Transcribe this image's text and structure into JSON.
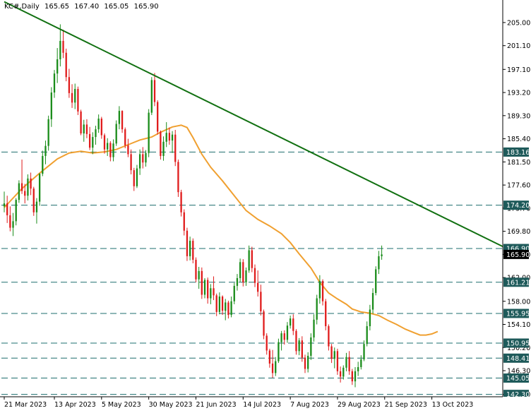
{
  "header": {
    "symbol": "KC#,Daily",
    "open": "165.65",
    "high": "167.40",
    "low": "165.05",
    "close": "165.90"
  },
  "colors": {
    "background": "#ffffff",
    "bull": "#1a8c1a",
    "bear": "#e01b1b",
    "ma": "#f0a030",
    "trendline": "#117011",
    "level": "#1e6f6f",
    "label_bg": "#1e5a5a",
    "price_bg": "#000000",
    "axis": "#000000"
  },
  "chart_data": {
    "type": "candlestick",
    "title": "KC#,Daily",
    "ylim": [
      141.9,
      208.8
    ],
    "y_ticks": [
      "205.00",
      "201.10",
      "197.10",
      "193.20",
      "189.30",
      "185.40",
      "181.50",
      "177.60",
      "173.70",
      "169.80",
      "165.90",
      "162.00",
      "158.00",
      "154.10",
      "150.20",
      "146.30",
      "142.30"
    ],
    "x_tick_labels": [
      {
        "label": "21 Mar 2023",
        "index": 0
      },
      {
        "label": "13 Apr 2023",
        "index": 17
      },
      {
        "label": "5 May 2023",
        "index": 33
      },
      {
        "label": "30 May 2023",
        "index": 49
      },
      {
        "label": "21 Jun 2023",
        "index": 65
      },
      {
        "label": "14 Jul 2023",
        "index": 81
      },
      {
        "label": "7 Aug 2023",
        "index": 97
      },
      {
        "label": "29 Aug 2023",
        "index": 113
      },
      {
        "label": "21 Sep 2023",
        "index": 129
      },
      {
        "label": "13 Oct 2023",
        "index": 145
      }
    ],
    "n_bars": 152,
    "levels": [
      "183.16",
      "174.20",
      "166.90",
      "161.21",
      "155.95",
      "150.95",
      "148.41",
      "145.05",
      "142.30"
    ],
    "current_price": "165.90",
    "trendline": {
      "start": {
        "index": 0,
        "value": 208.5
      },
      "end": {
        "index": 170,
        "value": 167.0
      }
    },
    "moving_average": [
      [
        0,
        173.8
      ],
      [
        6,
        177.0
      ],
      [
        12,
        179.6
      ],
      [
        18,
        182.0
      ],
      [
        22,
        183.0
      ],
      [
        26,
        183.3
      ],
      [
        30,
        183.0
      ],
      [
        34,
        183.2
      ],
      [
        38,
        183.6
      ],
      [
        42,
        184.4
      ],
      [
        46,
        185.2
      ],
      [
        50,
        185.7
      ],
      [
        53,
        186.5
      ],
      [
        57,
        187.4
      ],
      [
        60,
        187.7
      ],
      [
        62,
        187.3
      ],
      [
        64,
        185.6
      ],
      [
        67,
        182.8
      ],
      [
        70,
        180.6
      ],
      [
        74,
        178.3
      ],
      [
        78,
        175.8
      ],
      [
        82,
        173.3
      ],
      [
        86,
        171.8
      ],
      [
        90,
        170.7
      ],
      [
        94,
        169.4
      ],
      [
        97,
        167.9
      ],
      [
        100,
        166.0
      ],
      [
        104,
        163.6
      ],
      [
        107,
        161.2
      ],
      [
        110,
        159.4
      ],
      [
        113,
        158.4
      ],
      [
        116,
        157.5
      ],
      [
        118,
        156.7
      ],
      [
        121,
        156.2
      ],
      [
        124,
        156.0
      ],
      [
        127,
        155.6
      ],
      [
        130,
        154.8
      ],
      [
        133,
        154.1
      ],
      [
        136,
        153.3
      ],
      [
        139,
        152.7
      ],
      [
        141,
        152.3
      ],
      [
        143,
        152.3
      ],
      [
        145,
        152.5
      ],
      [
        147,
        152.9
      ]
    ],
    "ohlc": [
      [
        174.0,
        176.5,
        173.0,
        174.5
      ],
      [
        174.5,
        175.8,
        171.2,
        172.5
      ],
      [
        172.5,
        174.0,
        169.8,
        170.4
      ],
      [
        170.4,
        172.9,
        169.0,
        171.5
      ],
      [
        171.5,
        175.4,
        170.8,
        175.1
      ],
      [
        175.1,
        178.4,
        174.6,
        177.9
      ],
      [
        177.9,
        181.9,
        176.1,
        176.6
      ],
      [
        176.6,
        177.8,
        174.5,
        175.8
      ],
      [
        175.8,
        179.4,
        175.0,
        178.7
      ],
      [
        178.7,
        179.7,
        175.9,
        177.0
      ],
      [
        177.0,
        177.3,
        172.4,
        173.0
      ],
      [
        173.0,
        175.4,
        171.1,
        174.8
      ],
      [
        174.8,
        179.6,
        174.1,
        179.5
      ],
      [
        179.5,
        183.4,
        179.1,
        182.5
      ],
      [
        182.5,
        185.1,
        181.1,
        184.2
      ],
      [
        184.2,
        189.3,
        183.4,
        188.7
      ],
      [
        188.7,
        194.1,
        187.4,
        193.2
      ],
      [
        193.2,
        197.0,
        192.3,
        196.4
      ],
      [
        196.4,
        200.7,
        194.8,
        198.8
      ],
      [
        198.8,
        204.7,
        197.6,
        201.9
      ],
      [
        201.9,
        203.8,
        199.0,
        199.9
      ],
      [
        199.9,
        200.6,
        195.1,
        195.8
      ],
      [
        195.8,
        197.2,
        192.3,
        193.1
      ],
      [
        193.1,
        194.6,
        190.6,
        191.5
      ],
      [
        191.5,
        194.7,
        190.4,
        193.8
      ],
      [
        193.8,
        194.2,
        189.4,
        190.0
      ],
      [
        190.0,
        190.3,
        186.0,
        186.3
      ],
      [
        186.3,
        188.6,
        184.9,
        187.8
      ],
      [
        187.8,
        188.7,
        185.5,
        186.2
      ],
      [
        186.2,
        187.4,
        183.5,
        183.9
      ],
      [
        183.9,
        186.5,
        182.8,
        185.7
      ],
      [
        185.7,
        187.6,
        184.4,
        187.0
      ],
      [
        187.0,
        189.5,
        186.4,
        188.8
      ],
      [
        188.8,
        189.1,
        185.4,
        186.0
      ],
      [
        186.0,
        186.3,
        182.9,
        183.6
      ],
      [
        183.6,
        185.5,
        182.5,
        184.7
      ],
      [
        184.7,
        185.0,
        181.6,
        182.3
      ],
      [
        182.3,
        185.3,
        181.6,
        184.6
      ],
      [
        184.6,
        188.5,
        184.2,
        187.9
      ],
      [
        187.9,
        190.9,
        187.0,
        190.1
      ],
      [
        190.1,
        190.2,
        186.4,
        187.0
      ],
      [
        187.0,
        187.3,
        183.8,
        184.3
      ],
      [
        184.3,
        185.4,
        182.3,
        182.8
      ],
      [
        182.8,
        183.6,
        179.4,
        180.1
      ],
      [
        180.1,
        180.5,
        176.6,
        177.4
      ],
      [
        177.4,
        181.0,
        177.1,
        180.4
      ],
      [
        180.4,
        183.6,
        179.3,
        182.8
      ],
      [
        182.8,
        184.0,
        180.4,
        181.4
      ],
      [
        181.4,
        183.5,
        180.7,
        183.0
      ],
      [
        183.0,
        190.4,
        182.3,
        189.8
      ],
      [
        189.8,
        195.8,
        189.4,
        195.3
      ],
      [
        195.3,
        196.5,
        190.9,
        191.6
      ],
      [
        191.6,
        191.9,
        186.1,
        186.6
      ],
      [
        186.6,
        186.8,
        181.9,
        182.5
      ],
      [
        182.5,
        185.8,
        181.7,
        184.9
      ],
      [
        184.9,
        188.2,
        184.0,
        186.4
      ],
      [
        186.4,
        187.3,
        184.4,
        185.1
      ],
      [
        185.1,
        186.7,
        183.0,
        186.1
      ],
      [
        186.1,
        186.9,
        180.8,
        181.5
      ],
      [
        181.5,
        181.9,
        175.6,
        176.4
      ],
      [
        176.4,
        176.8,
        172.3,
        173.0
      ],
      [
        173.0,
        173.5,
        169.1,
        169.9
      ],
      [
        169.9,
        170.4,
        164.8,
        165.6
      ],
      [
        165.6,
        168.9,
        164.9,
        168.2
      ],
      [
        168.2,
        168.6,
        164.4,
        165.0
      ],
      [
        165.0,
        165.4,
        161.2,
        161.7
      ],
      [
        161.7,
        163.8,
        160.1,
        163.1
      ],
      [
        163.1,
        163.7,
        158.4,
        159.1
      ],
      [
        159.1,
        161.9,
        158.5,
        161.6
      ],
      [
        161.6,
        162.0,
        157.6,
        158.5
      ],
      [
        158.5,
        160.9,
        157.5,
        160.2
      ],
      [
        160.2,
        162.2,
        158.2,
        159.0
      ],
      [
        159.0,
        159.3,
        155.5,
        156.2
      ],
      [
        156.2,
        159.5,
        155.8,
        158.8
      ],
      [
        158.8,
        159.0,
        155.7,
        156.4
      ],
      [
        156.4,
        158.4,
        154.8,
        157.8
      ],
      [
        157.8,
        158.1,
        155.1,
        155.7
      ],
      [
        155.7,
        158.8,
        155.3,
        158.0
      ],
      [
        158.0,
        161.1,
        157.5,
        160.6
      ],
      [
        160.6,
        162.6,
        159.8,
        161.9
      ],
      [
        161.9,
        165.2,
        161.3,
        164.6
      ],
      [
        164.6,
        165.1,
        160.5,
        161.2
      ],
      [
        161.2,
        163.7,
        160.6,
        163.2
      ],
      [
        163.2,
        167.4,
        162.8,
        166.6
      ],
      [
        166.6,
        167.2,
        162.9,
        163.6
      ],
      [
        163.6,
        164.2,
        160.4,
        161.1
      ],
      [
        161.1,
        163.2,
        158.8,
        159.6
      ],
      [
        159.6,
        160.8,
        155.6,
        156.3
      ],
      [
        156.3,
        156.6,
        151.6,
        152.2
      ],
      [
        152.2,
        152.6,
        149.0,
        149.7
      ],
      [
        149.7,
        150.0,
        146.8,
        147.5
      ],
      [
        147.5,
        149.8,
        145.1,
        145.9
      ],
      [
        145.9,
        148.6,
        145.4,
        147.9
      ],
      [
        147.9,
        151.7,
        147.6,
        151.1
      ],
      [
        151.1,
        153.0,
        149.7,
        152.6
      ],
      [
        152.6,
        153.1,
        150.7,
        151.5
      ],
      [
        151.5,
        154.5,
        151.0,
        153.9
      ],
      [
        153.9,
        155.6,
        153.4,
        155.1
      ],
      [
        155.1,
        155.8,
        152.3,
        153.0
      ],
      [
        153.0,
        153.3,
        149.0,
        149.6
      ],
      [
        149.6,
        151.8,
        148.9,
        151.4
      ],
      [
        151.4,
        152.1,
        147.8,
        148.5
      ],
      [
        148.5,
        149.0,
        145.9,
        146.6
      ],
      [
        146.6,
        149.4,
        146.0,
        148.8
      ],
      [
        148.8,
        152.6,
        148.1,
        151.9
      ],
      [
        151.9,
        155.8,
        151.2,
        154.9
      ],
      [
        154.9,
        159.1,
        154.1,
        158.5
      ],
      [
        158.5,
        162.4,
        157.6,
        161.4
      ],
      [
        161.4,
        161.7,
        157.3,
        158.0
      ],
      [
        158.0,
        158.4,
        153.1,
        153.8
      ],
      [
        153.8,
        154.1,
        149.7,
        150.4
      ],
      [
        150.4,
        150.8,
        147.6,
        148.3
      ],
      [
        148.3,
        150.2,
        146.7,
        149.6
      ],
      [
        149.6,
        150.0,
        145.6,
        146.2
      ],
      [
        146.2,
        147.0,
        144.3,
        145.3
      ],
      [
        145.3,
        147.2,
        144.8,
        146.8
      ],
      [
        146.8,
        149.3,
        146.2,
        148.6
      ],
      [
        148.6,
        149.6,
        145.6,
        146.2
      ],
      [
        146.2,
        146.6,
        143.9,
        144.5
      ],
      [
        144.5,
        146.9,
        143.5,
        146.2
      ],
      [
        146.2,
        147.8,
        145.4,
        146.9
      ],
      [
        146.9,
        148.9,
        146.5,
        148.2
      ],
      [
        148.2,
        151.4,
        147.9,
        150.8
      ],
      [
        150.8,
        154.6,
        150.4,
        153.8
      ],
      [
        153.8,
        157.4,
        153.1,
        156.6
      ],
      [
        156.6,
        160.2,
        155.9,
        159.4
      ],
      [
        159.4,
        163.9,
        159.0,
        163.4
      ],
      [
        163.4,
        166.5,
        162.6,
        165.6
      ],
      [
        165.6,
        167.4,
        165.0,
        165.9
      ]
    ]
  }
}
